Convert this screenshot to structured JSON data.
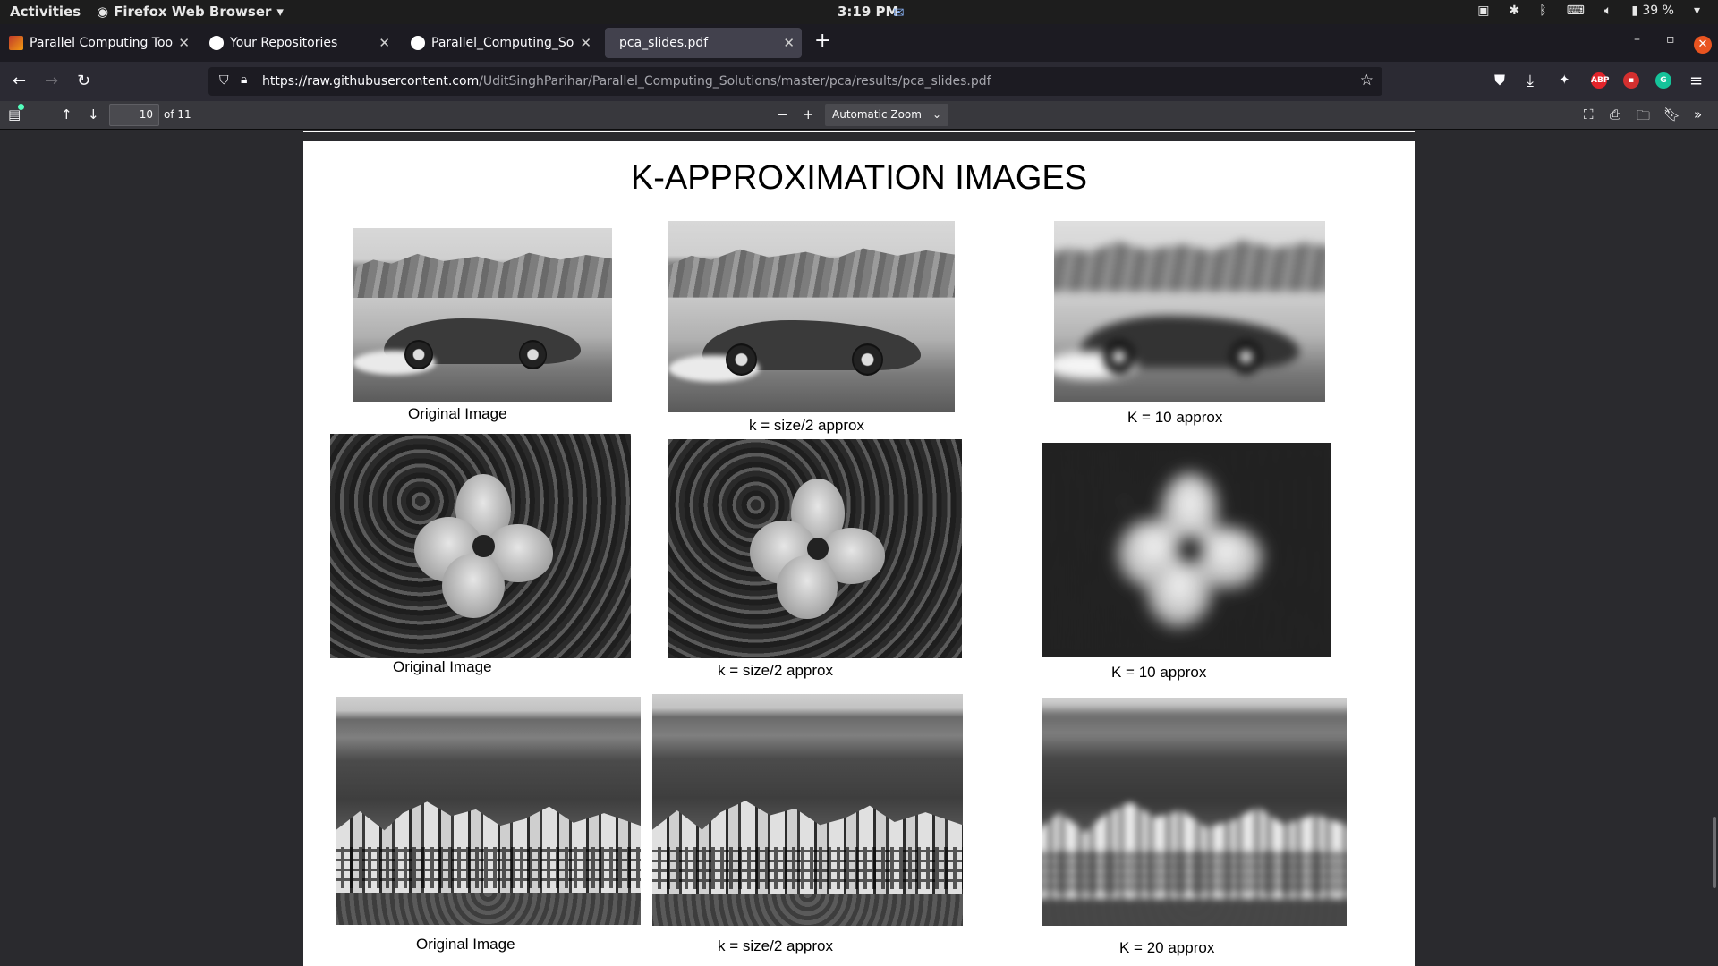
{
  "topbar": {
    "activities": "Activities",
    "app_name": "Firefox Web Browser",
    "clock": "3:19 PM",
    "battery": "39 %"
  },
  "tabs": [
    {
      "title": "Parallel Computing Toolbox",
      "favicon": "matlab-icon"
    },
    {
      "title": "Your Repositories",
      "favicon": "github-icon"
    },
    {
      "title": "Parallel_Computing_Solutio",
      "favicon": "github-icon"
    },
    {
      "title": "pca_slides.pdf",
      "favicon": "",
      "active": true
    }
  ],
  "urlbar": {
    "host": "https://raw.githubusercontent.com",
    "path": "/UditSinghParihar/Parallel_Computing_Solutions/master/pca/results/pca_slides.pdf"
  },
  "extensions": [
    {
      "name": "abp-icon",
      "label": "ABP",
      "color": "#e3242b"
    },
    {
      "name": "lock-ext-icon",
      "label": "",
      "color": "#d32f2f"
    },
    {
      "name": "grammarly-icon",
      "label": "G",
      "color": "#15c39a"
    }
  ],
  "pdf_toolbar": {
    "page_number": "10",
    "page_of": "of 11",
    "zoom": "Automatic Zoom"
  },
  "slide": {
    "title": "K-APPROXIMATION IMAGES",
    "rows": [
      {
        "scene": "car",
        "captions": [
          "Original Image",
          "k = size/2 approx",
          "K = 10 approx"
        ]
      },
      {
        "scene": "flower",
        "captions": [
          "Original Image",
          "k = size/2 approx",
          "K = 10 approx"
        ]
      },
      {
        "scene": "town",
        "captions": [
          "Original Image",
          "k = size/2 approx",
          "K = 20 approx"
        ]
      }
    ]
  }
}
